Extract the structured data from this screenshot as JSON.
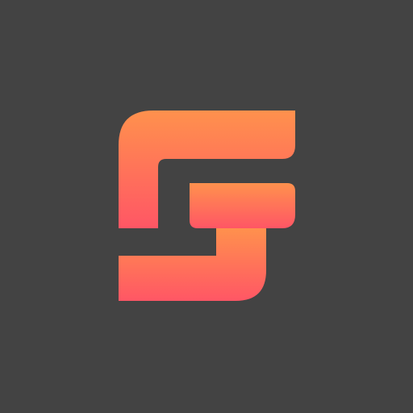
{
  "app_icon": {
    "background_color": "#434343",
    "logo": {
      "icon_name": "gradient-s-g-monogram-icon",
      "gradient_top_color": "#FF914D",
      "gradient_bottom_color": "#FF5665"
    }
  }
}
